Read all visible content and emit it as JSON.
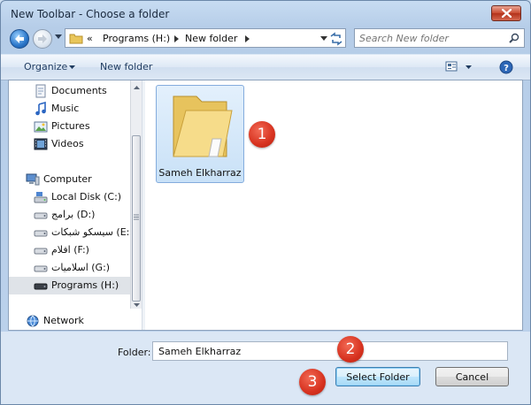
{
  "window": {
    "title": "New Toolbar - Choose a folder"
  },
  "address_bar": {
    "chevron": "«",
    "segments": [
      "Programs (H:)",
      "New folder"
    ],
    "search_placeholder": "Search New folder"
  },
  "toolbar": {
    "organize_label": "Organize",
    "new_folder_label": "New folder"
  },
  "navigation": {
    "items": [
      {
        "label": "Documents",
        "icon": "documents-icon"
      },
      {
        "label": "Music",
        "icon": "music-icon"
      },
      {
        "label": "Pictures",
        "icon": "pictures-icon"
      },
      {
        "label": "Videos",
        "icon": "videos-icon"
      },
      {
        "label": "Computer",
        "icon": "computer-icon"
      },
      {
        "label": "Local Disk (C:)",
        "icon": "local-disk-icon"
      },
      {
        "label": "برامج (D:)",
        "icon": "drive-icon"
      },
      {
        "label": "سيسكو شبكات (E:)",
        "icon": "drive-icon"
      },
      {
        "label": "افلام (F:)",
        "icon": "drive-icon"
      },
      {
        "label": "اسلاميات (G:)",
        "icon": "drive-icon"
      },
      {
        "label": "Programs (H:)",
        "icon": "drive-icon",
        "selected": true
      },
      {
        "label": "Network",
        "icon": "network-icon"
      }
    ]
  },
  "files": {
    "items": [
      {
        "name": "Sameh Elkharraz",
        "icon": "folder-icon"
      }
    ]
  },
  "annotations": [
    "1",
    "2",
    "3"
  ],
  "footer": {
    "folder_label": "Folder:",
    "folder_value": "Sameh Elkharraz",
    "select_button": "Select Folder",
    "cancel_button": "Cancel"
  },
  "colors": {
    "selection": "#cde6f7",
    "badge": "#d7321f",
    "close_button": "#c9492f"
  }
}
